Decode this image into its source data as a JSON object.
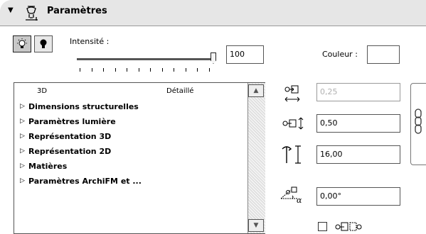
{
  "header": {
    "title": "Paramètres"
  },
  "light": {
    "intensity_label": "Intensité :",
    "intensity_value": "100",
    "intensity_level": 1.0,
    "color_label": "Couleur :"
  },
  "list": {
    "col1": "3D",
    "col2": "Détaillé",
    "items": [
      "Dimensions structurelles",
      "Paramètres lumière",
      "Représentation 3D",
      "Représentation 2D",
      "Matières",
      "Paramètres ArchiFM et ..."
    ]
  },
  "fields": {
    "width": "0,25",
    "depth": "0,50",
    "height": "16,00",
    "angle": "0,00°"
  },
  "icons": {
    "header": "lamp-icon",
    "lamp_on": "lamp-on-icon",
    "lamp_off": "lamp-off-icon",
    "width": "width-icon",
    "depth": "depth-icon",
    "height": "height-icon",
    "angle": "rotation-angle-icon",
    "chain": "chain-link-icon",
    "anchor": "anchor-point-icon"
  }
}
